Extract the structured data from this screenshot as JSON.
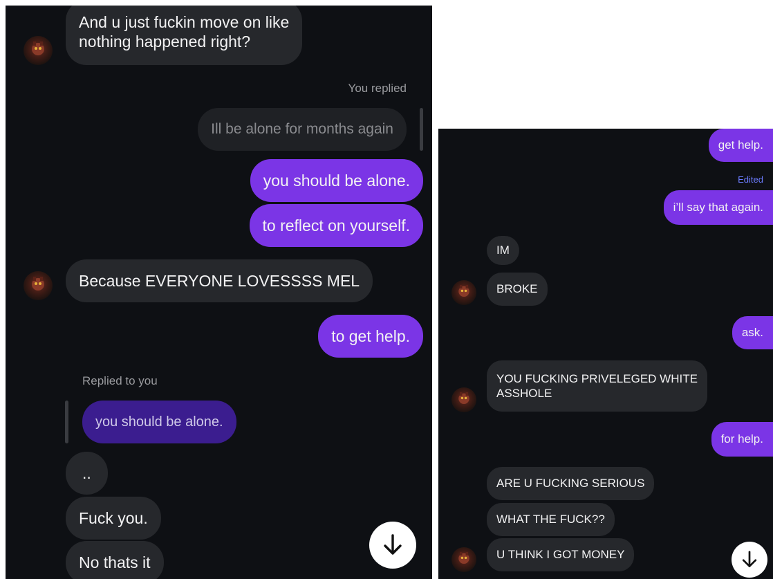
{
  "left": {
    "messages": [
      {
        "type": "received",
        "text": "And u just fuckin move on like\nnothing happened right?"
      },
      {
        "type": "label",
        "text": "You replied"
      },
      {
        "type": "reply_quote",
        "text": "Ill be alone for months again"
      },
      {
        "type": "sent",
        "text": "you should be alone."
      },
      {
        "type": "sent",
        "text": "to reflect on yourself."
      },
      {
        "type": "received",
        "text": "Because EVERYONE LOVESSSS MEL"
      },
      {
        "type": "sent",
        "text": "to get help."
      },
      {
        "type": "label",
        "text": "Replied to you"
      },
      {
        "type": "reply_quote",
        "text": "you should be alone."
      },
      {
        "type": "received",
        "text": ".."
      },
      {
        "type": "received",
        "text": "Fuck you."
      },
      {
        "type": "received",
        "text": "No thats it"
      }
    ]
  },
  "right": {
    "messages": [
      {
        "type": "sent",
        "text": "get help."
      },
      {
        "type": "edited_label",
        "text": "Edited"
      },
      {
        "type": "sent",
        "text": "i’ll say that again."
      },
      {
        "type": "received",
        "text": "IM"
      },
      {
        "type": "received",
        "text": "BROKE"
      },
      {
        "type": "sent",
        "text": "ask."
      },
      {
        "type": "received",
        "text": "YOU FUCKING PRIVELEGED WHITE\nASSHOLE"
      },
      {
        "type": "sent",
        "text": "for help."
      },
      {
        "type": "received",
        "text": "ARE U FUCKING SERIOUS"
      },
      {
        "type": "received",
        "text": "WHAT THE FUCK??"
      },
      {
        "type": "received",
        "text": "U THINK I GOT MONEY"
      }
    ]
  },
  "icons": {
    "avatar": "profile-avatar-icon",
    "scroll": "arrow-down-icon"
  },
  "colors": {
    "background": "#0e1014",
    "sent_bubble": "#7b35e6",
    "received_bubble": "#26282c",
    "reply_quote": "#3b1d8f",
    "edited_label": "#6c7cff"
  }
}
